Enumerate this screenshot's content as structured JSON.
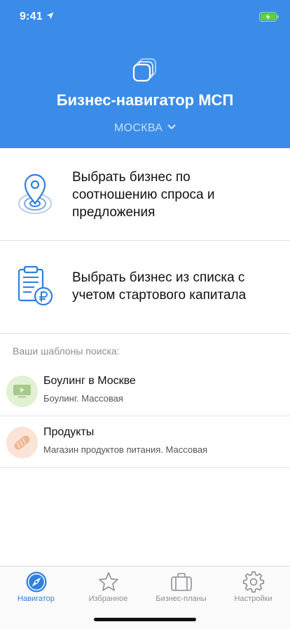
{
  "status": {
    "time": "9:41"
  },
  "header": {
    "title": "Бизнес-навигатор МСП",
    "city": "МОСКВА"
  },
  "options": [
    {
      "label": "Выбрать бизнес по соотношению спроса и предложения",
      "icon": "map-pin-radar-icon"
    },
    {
      "label": "Выбрать бизнес из списка с учетом стартового капитала",
      "icon": "clipboard-ruble-icon"
    }
  ],
  "templates": {
    "title": "Ваши шаблоны поиска:",
    "items": [
      {
        "title": "Боулинг в Москве",
        "subtitle": "Боулинг. Массовая",
        "icon": "tv-icon",
        "color": "#e2f1d3"
      },
      {
        "title": "Продукты",
        "subtitle": "Магазин продуктов питания. Массовая",
        "icon": "bread-icon",
        "color": "#fbe3d6"
      }
    ]
  },
  "tabs": [
    {
      "label": "Навигатор",
      "icon": "compass-icon",
      "active": true
    },
    {
      "label": "Избранное",
      "icon": "star-icon",
      "active": false
    },
    {
      "label": "Бизнес-планы",
      "icon": "briefcase-icon",
      "active": false
    },
    {
      "label": "Настройки",
      "icon": "gear-icon",
      "active": false
    }
  ],
  "colors": {
    "header": "#3a8ce8",
    "accent": "#2f7fe0",
    "icon_inactive": "#8e8e93"
  }
}
